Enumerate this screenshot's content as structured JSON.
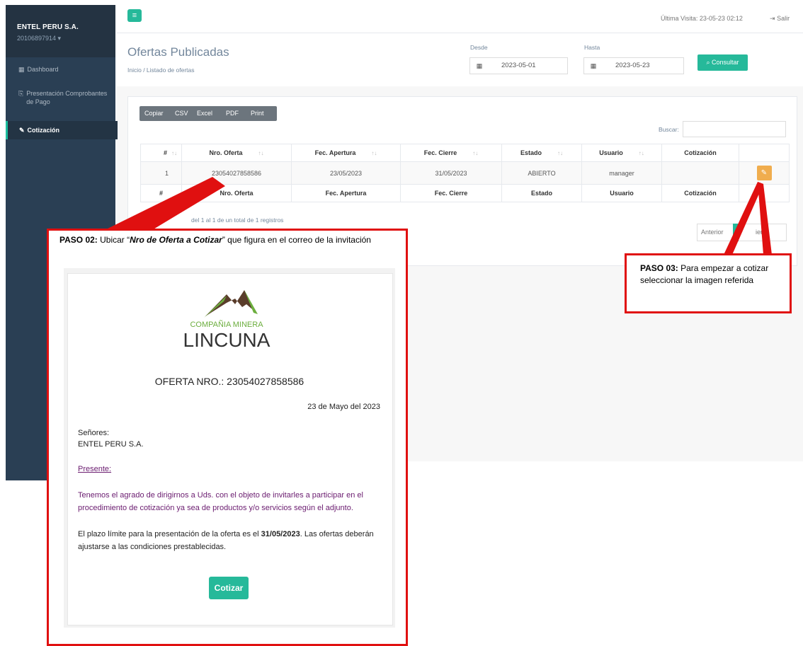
{
  "sidebar": {
    "company": "ENTEL PERU S.A.",
    "ruc": "20106897914 ▾",
    "items": [
      {
        "label": "Dashboard",
        "icon": "dashboard-icon"
      },
      {
        "label": "Presentación Comprobantes de Pago",
        "icon": "document-icon"
      },
      {
        "label": "Cotización",
        "icon": "edit-icon",
        "active": true
      }
    ]
  },
  "topbar": {
    "last_visit": "Última Visita: 23-05-23 02:12",
    "logout": "Salir"
  },
  "page": {
    "title": "Ofertas Publicadas",
    "breadcrumb": "Inicio / Listado de ofertas"
  },
  "filters": {
    "desde_label": "Desde",
    "desde_value": "2023-05-01",
    "hasta_label": "Hasta",
    "hasta_value": "2023-05-23",
    "consultar": "Consultar"
  },
  "export_buttons": [
    "Copiar",
    "CSV",
    "Excel",
    "PDF",
    "Print"
  ],
  "search": {
    "label": "Buscar:",
    "value": ""
  },
  "table": {
    "headers": [
      "#",
      "Nro. Oferta",
      "Fec. Apertura",
      "Fec. Cierre",
      "Estado",
      "Usuario",
      "Cotización"
    ],
    "rows": [
      [
        "1",
        "23054027858586",
        "23/05/2023",
        "31/05/2023",
        "ABIERTO",
        "manager",
        ""
      ]
    ],
    "info": "del 1 al 1 de un total de 1 registros"
  },
  "pagination": {
    "prev": "Anterior",
    "next": "iente"
  },
  "paso2": {
    "bold": "PASO 02:",
    "pre": " Ubicar “",
    "emph": "Nro de Oferta a Cotizar",
    "post": "” que figura en el correo de la invitación"
  },
  "email": {
    "logo_top": "COMPAÑIA MINERA",
    "logo_bottom": "LINCUNA",
    "oferta": "OFERTA NRO.: 23054027858586",
    "date": "23 de Mayo del 2023",
    "senores": "Señores:",
    "company": "ENTEL PERU S.A.",
    "presente": "Presente:",
    "p1": "Tenemos el agrado de dirigirnos a Uds. con el objeto de invitarles a participar en el procedimiento de cotización ya sea de productos y/o servicios según el adjunto.",
    "p2_pre": "El plazo límite para la presentación de la oferta es el ",
    "p2_bold": "31/05/2023",
    "p2_post": ". Las ofertas deberán ajustarse a las condiciones prestablecidas.",
    "button": "Cotizar"
  },
  "paso3": {
    "bold": "PASO 03:",
    "text": " Para empezar a cotizar seleccionar la imagen referida"
  },
  "colors": {
    "sidebar": "#2a3f54",
    "accent": "#26b99a",
    "warning": "#f0ad4e",
    "annotation": "#e01010"
  }
}
